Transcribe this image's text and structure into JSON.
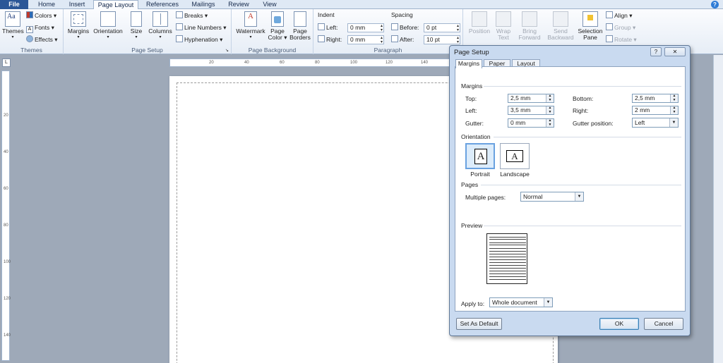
{
  "ribbon_tabs": [
    "File",
    "Home",
    "Insert",
    "Page Layout",
    "References",
    "Mailings",
    "Review",
    "View"
  ],
  "help_glyph": "?",
  "themes_group": {
    "label": "Themes",
    "themes_label": "Themes",
    "colors_label": "Colors",
    "fonts_label": "Fonts",
    "effects_label": "Effects"
  },
  "page_setup_group": {
    "label": "Page Setup",
    "margins_label": "Margins",
    "orientation_label": "Orientation",
    "size_label": "Size",
    "columns_label": "Columns",
    "breaks_label": "Breaks",
    "line_numbers_label": "Line Numbers",
    "hyphenation_label": "Hyphenation"
  },
  "page_background_group": {
    "label": "Page Background",
    "watermark_label": "Watermark",
    "page_color_label": "Page Color",
    "page_borders_label": "Page Borders"
  },
  "paragraph_group": {
    "label": "Paragraph",
    "indent_heading": "Indent",
    "indent_left_label": "Left:",
    "indent_left_value": "0 mm",
    "indent_right_label": "Right:",
    "indent_right_value": "0 mm",
    "spacing_heading": "Spacing",
    "before_label": "Before:",
    "before_value": "0 pt",
    "after_label": "After:",
    "after_value": "10 pt"
  },
  "arrange_group": {
    "position_label": "Position",
    "wrap_text_label": "Wrap Text",
    "bring_forward_label": "Bring Forward",
    "send_backward_label": "Send Backward",
    "selection_pane_label": "Selection Pane",
    "align_label": "Align",
    "group_label": "Group",
    "rotate_label": "Rotate"
  },
  "ruler_corner_glyph": "L",
  "hruler_numbers": [
    "20",
    "40",
    "60",
    "80",
    "100",
    "120",
    "140"
  ],
  "vruler_numbers": [
    "20",
    "40",
    "60",
    "80",
    "100",
    "120",
    "140"
  ],
  "dialog": {
    "title": "Page Setup",
    "help_button": "?",
    "close_button": "✕",
    "tabs": [
      "Margins",
      "Paper",
      "Layout"
    ],
    "margins_section": "Margins",
    "top_label": "Top:",
    "top_value": "2,5 mm",
    "bottom_label": "Bottom:",
    "bottom_value": "2,5 mm",
    "left_label": "Left:",
    "left_value": "3,5 mm",
    "right_label": "Right:",
    "right_value": "2 mm",
    "gutter_label": "Gutter:",
    "gutter_value": "0 mm",
    "gutter_position_label": "Gutter position:",
    "gutter_position_value": "Left",
    "orientation_section": "Orientation",
    "portrait_label": "Portrait",
    "landscape_label": "Landscape",
    "orientation_glyph": "A",
    "pages_section": "Pages",
    "multiple_pages_label": "Multiple pages:",
    "multiple_pages_value": "Normal",
    "preview_section": "Preview",
    "apply_to_label": "Apply to:",
    "apply_to_value": "Whole document",
    "set_default_button": "Set As Default",
    "ok_button": "OK",
    "cancel_button": "Cancel"
  },
  "colors": {
    "file_tab": "#2b5797",
    "dialog_frame": "#c9daf0",
    "selected_orientation": "#dcecfb"
  }
}
